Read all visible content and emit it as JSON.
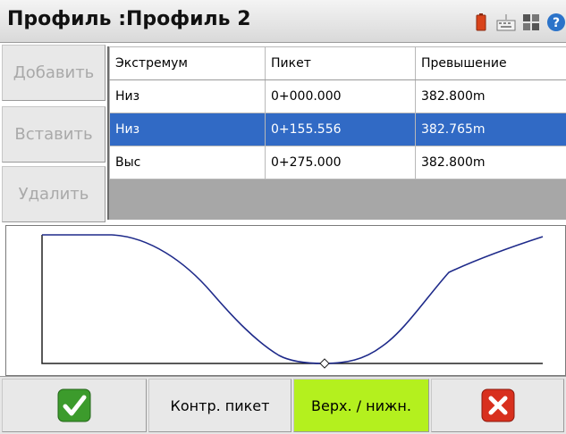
{
  "window": {
    "title": "Профиль :Профиль 2",
    "tray_icons": [
      "battery-icon",
      "keyboard-icon",
      "grid-icon",
      "help-icon"
    ]
  },
  "side_buttons": [
    "Добавить",
    "Вставить",
    "Удалить"
  ],
  "table": {
    "columns": [
      "Экстремум",
      "Пикет",
      "Превышение"
    ],
    "rows": [
      [
        "Низ",
        "0+000.000",
        "382.800m"
      ],
      [
        "Низ",
        "0+155.556",
        "382.765m"
      ],
      [
        "Выс",
        "0+275.000",
        "382.800m"
      ]
    ],
    "selected_row": 1
  },
  "toolbar": {
    "ok_icon": "checkmark-icon",
    "control_station_label": "Контр. пикет",
    "top_bottom_label": "Верх. / нижн.",
    "cancel_icon": "close-icon"
  },
  "colors": {
    "selection": "#316ac5",
    "active_button": "#b4f01e",
    "profile_line": "#1e2a8a",
    "ok_green": "#3c9b2c",
    "cancel_red": "#d8301e"
  }
}
